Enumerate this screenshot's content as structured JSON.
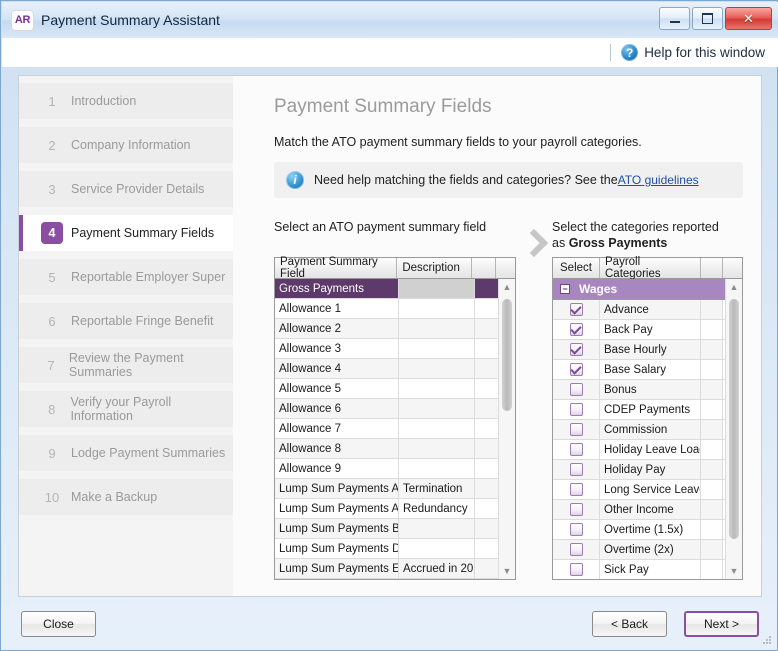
{
  "window": {
    "badge": "AR",
    "title": "Payment Summary Assistant",
    "minimize_label": "",
    "maximize_label": "",
    "close_label": "✕"
  },
  "helpbar": {
    "icon": "question-mark-icon",
    "icon_glyph": "?",
    "label": "Help for this window"
  },
  "sidebar": {
    "items": [
      {
        "num": "1",
        "label": "Introduction"
      },
      {
        "num": "2",
        "label": "Company Information"
      },
      {
        "num": "3",
        "label": "Service Provider Details"
      },
      {
        "num": "4",
        "label": "Payment Summary Fields"
      },
      {
        "num": "5",
        "label": "Reportable Employer Super"
      },
      {
        "num": "6",
        "label": "Reportable Fringe Benefit"
      },
      {
        "num": "7",
        "label": "Review the Payment Summaries"
      },
      {
        "num": "8",
        "label": "Verify your Payroll Information"
      },
      {
        "num": "9",
        "label": "Lodge Payment Summaries"
      },
      {
        "num": "10",
        "label": "Make a Backup"
      }
    ],
    "active_index": 3
  },
  "content": {
    "title": "Payment Summary Fields",
    "subtitle": "Match the ATO payment summary fields to your payroll categories.",
    "notice": {
      "icon": "info-icon",
      "icon_glyph": "i",
      "text": "Need help matching the fields and categories? See the ",
      "link": "ATO guidelines"
    },
    "left_caption": "Select an ATO payment summary field",
    "arrow_icon": "chevron-right-icon",
    "right_caption_line1": "Select the categories reported",
    "right_caption_prefix": "as ",
    "right_caption_bold": "Gross Payments"
  },
  "fields_grid": {
    "headers": [
      "Payment Summary Field",
      "Description",
      "",
      ""
    ],
    "rows": [
      {
        "field": "Gross Payments",
        "description": "",
        "selected": true
      },
      {
        "field": "Allowance 1",
        "description": ""
      },
      {
        "field": "Allowance 2",
        "description": ""
      },
      {
        "field": "Allowance 3",
        "description": ""
      },
      {
        "field": "Allowance 4",
        "description": ""
      },
      {
        "field": "Allowance 5",
        "description": ""
      },
      {
        "field": "Allowance 6",
        "description": ""
      },
      {
        "field": "Allowance 7",
        "description": ""
      },
      {
        "field": "Allowance 8",
        "description": ""
      },
      {
        "field": "Allowance 9",
        "description": ""
      },
      {
        "field": "Lump Sum Payments A",
        "description": "Termination"
      },
      {
        "field": "Lump Sum Payments A",
        "description": "Redundancy"
      },
      {
        "field": "Lump Sum Payments B",
        "description": ""
      },
      {
        "field": "Lump Sum Payments D",
        "description": ""
      },
      {
        "field": "Lump Sum Payments E",
        "description": "Accrued in 20"
      }
    ]
  },
  "categories_grid": {
    "headers": [
      "Select",
      "Payroll Categories",
      "",
      ""
    ],
    "group": {
      "name": "Wages",
      "expander": "−"
    },
    "rows": [
      {
        "label": "Advance",
        "checked": true
      },
      {
        "label": "Back Pay",
        "checked": true
      },
      {
        "label": "Base Hourly",
        "checked": true
      },
      {
        "label": "Base Salary",
        "checked": true
      },
      {
        "label": "Bonus",
        "checked": false
      },
      {
        "label": "CDEP Payments",
        "checked": false
      },
      {
        "label": "Commission",
        "checked": false
      },
      {
        "label": "Holiday Leave Loadir",
        "checked": false
      },
      {
        "label": "Holiday Pay",
        "checked": false
      },
      {
        "label": "Long Service Leave",
        "checked": false
      },
      {
        "label": "Other Income",
        "checked": false
      },
      {
        "label": "Overtime (1.5x)",
        "checked": false
      },
      {
        "label": "Overtime (2x)",
        "checked": false
      },
      {
        "label": "Sick Pay",
        "checked": false
      }
    ]
  },
  "footer": {
    "close": "Close",
    "back": "< Back",
    "next": "Next >"
  },
  "colors": {
    "accent_purple": "#8a4fa3",
    "selection_purple": "#5d3a6b",
    "group_purple": "#a886bf",
    "link_blue": "#1d4fa8",
    "title_gray": "#9b9b9b"
  }
}
